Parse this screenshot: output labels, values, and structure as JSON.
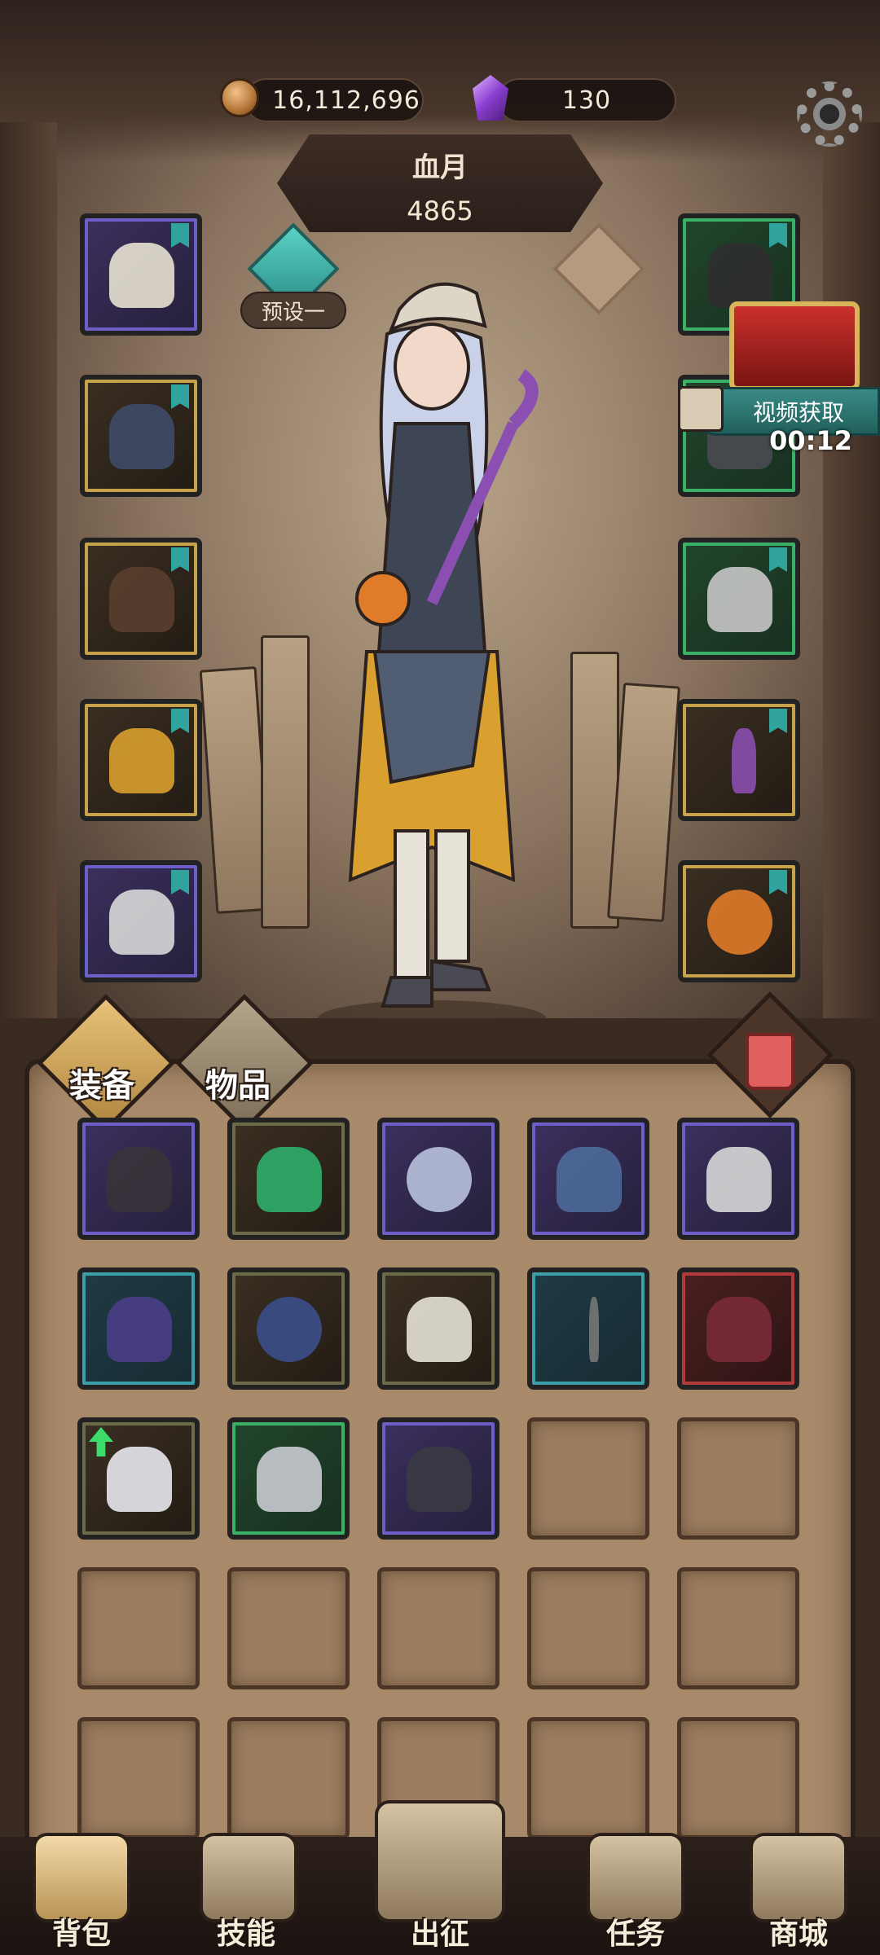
{
  "currency": {
    "gold": "16,112,696",
    "gems": "130",
    "gold_icon": "coin-icon",
    "gem_icon": "crystal-icon"
  },
  "character": {
    "name": "血月",
    "power": "4865"
  },
  "preset": {
    "label": "预设一"
  },
  "reward": {
    "label": "视频获取",
    "timer": "00:12"
  },
  "tabs": {
    "equipment": "装备",
    "items": "物品"
  },
  "equipped_left": [
    "hat",
    "dress",
    "gloves",
    "skirt",
    "boots"
  ],
  "equipped_right": [
    "necklace",
    "ring",
    "amulet",
    "staff",
    "orb"
  ],
  "inventory": [
    "boots",
    "emerald-amulet",
    "magnifier-wand",
    "helmet-pendant",
    "hourglass-pendant",
    "wizard-hat",
    "blue-ring",
    "white-shirt",
    "dark-wand",
    "red-glove",
    "white-hat",
    "ruffled-dress",
    "tattered-robe",
    "",
    "",
    "",
    "",
    "",
    "",
    "",
    "",
    "",
    "",
    "",
    ""
  ],
  "nav": {
    "backpack": "背包",
    "skills": "技能",
    "battle": "出征",
    "quests": "任务",
    "shop": "商城"
  },
  "colors": {
    "purple_rarity": "#6d5fc8",
    "gold_rarity": "#c8a24a",
    "green_rarity": "#3ab066",
    "teal_rarity": "#3a9fa6",
    "red_rarity": "#b23a3a",
    "accent_teal": "#2fa39c"
  }
}
